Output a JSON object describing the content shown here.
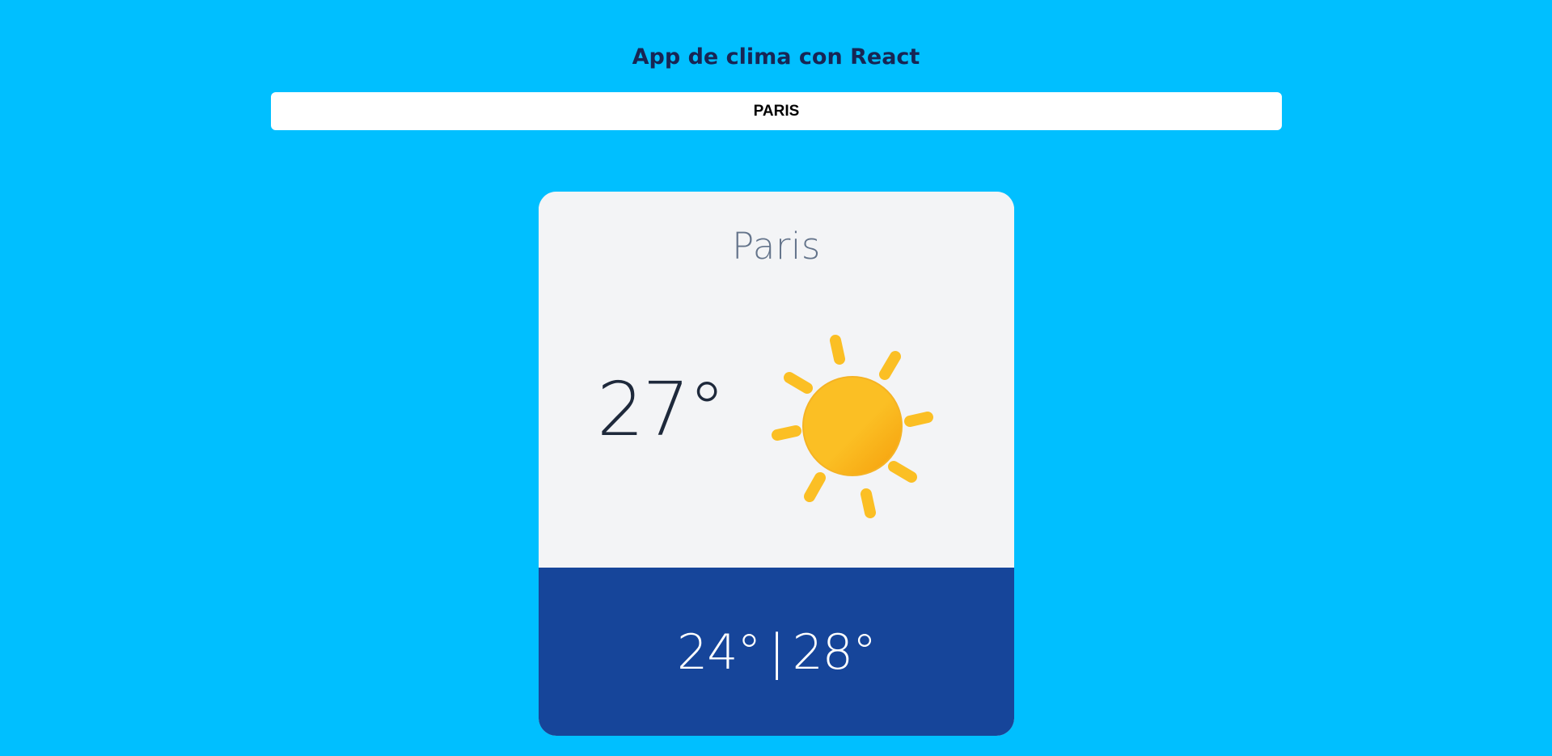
{
  "header": {
    "title": "App de clima con React"
  },
  "search": {
    "value": "PARIS"
  },
  "weather": {
    "city": "Paris",
    "temperature": "27°",
    "condition_icon": "sun-icon",
    "min": "24°",
    "separator": "|",
    "max": "28°"
  },
  "colors": {
    "background": "#00BFFF",
    "card_top": "#F3F4F6",
    "card_bottom": "#16459A",
    "title": "#172554",
    "sun": "#FBBF24"
  }
}
